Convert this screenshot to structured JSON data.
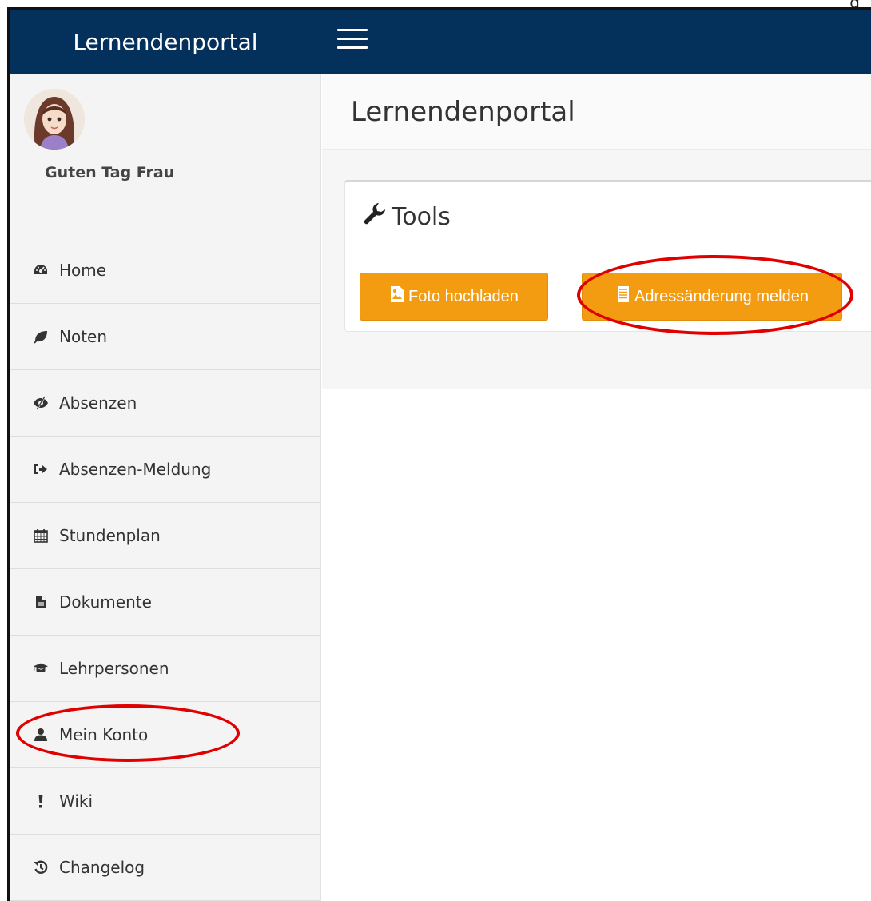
{
  "page_corner_text": "g",
  "header": {
    "brand": "Lernendenportal",
    "menu_icon": "hamburger-icon"
  },
  "sidebar": {
    "greeting": "Guten Tag Frau",
    "items": [
      {
        "label": "Home",
        "icon": "dashboard-icon"
      },
      {
        "label": "Noten",
        "icon": "leaf-icon"
      },
      {
        "label": "Absenzen",
        "icon": "eye-slash-icon"
      },
      {
        "label": "Absenzen-Meldung",
        "icon": "sign-in-icon"
      },
      {
        "label": "Stundenplan",
        "icon": "calendar-icon"
      },
      {
        "label": "Dokumente",
        "icon": "file-icon"
      },
      {
        "label": "Lehrpersonen",
        "icon": "graduation-cap-icon"
      },
      {
        "label": "Mein Konto",
        "icon": "user-icon"
      },
      {
        "label": "Wiki",
        "icon": "exclamation-icon"
      },
      {
        "label": "Changelog",
        "icon": "history-icon"
      }
    ]
  },
  "main": {
    "title": "Lernendenportal",
    "panel": {
      "title": "Tools",
      "buttons": [
        {
          "label": "Foto hochladen",
          "icon": "image-file-icon"
        },
        {
          "label": "Adressänderung melden",
          "icon": "list-file-icon"
        }
      ]
    }
  },
  "colors": {
    "topbar": "#04315c",
    "button": "#f39c12",
    "annotation": "#e00000"
  }
}
